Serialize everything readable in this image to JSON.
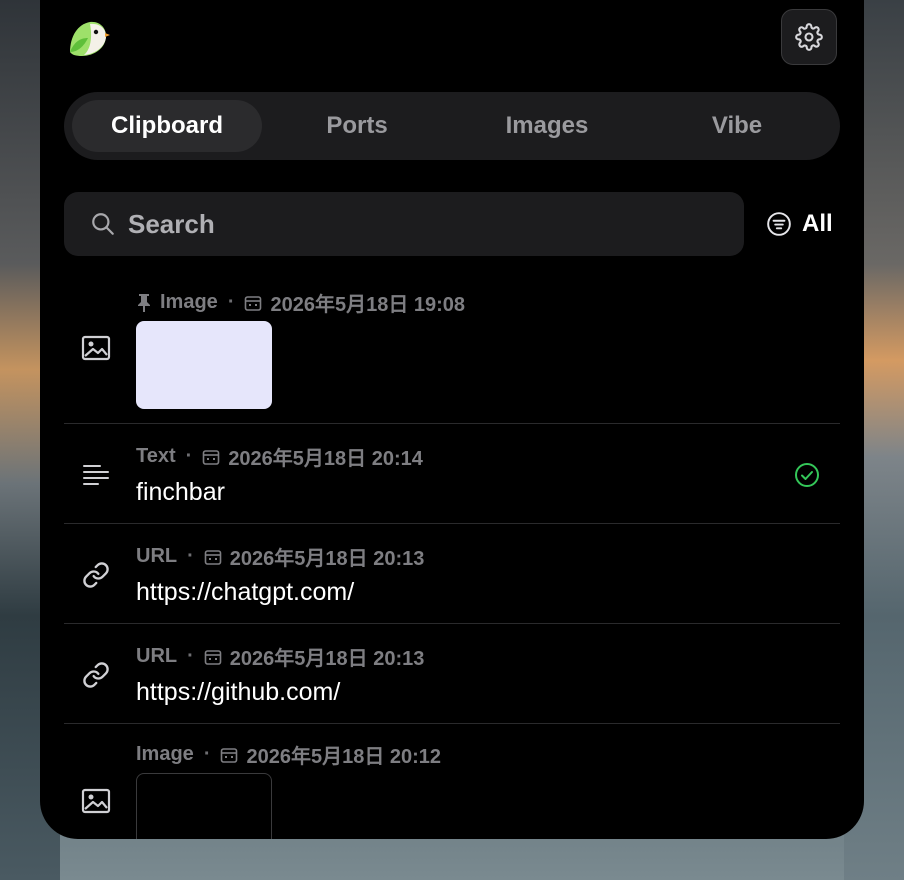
{
  "tabs": [
    {
      "label": "Clipboard",
      "active": true
    },
    {
      "label": "Ports",
      "active": false
    },
    {
      "label": "Images",
      "active": false
    },
    {
      "label": "Vibe",
      "active": false
    }
  ],
  "search": {
    "placeholder": "Search"
  },
  "filter": {
    "label": "All"
  },
  "items": [
    {
      "type": "Image",
      "pinned": true,
      "date": "2026年5月18日 19:08",
      "icon": "image-icon",
      "thumb_color": "#e6e6fb"
    },
    {
      "type": "Text",
      "date": "2026年5月18日 20:14",
      "content": "finchbar",
      "icon": "text-lines-icon",
      "selected": true
    },
    {
      "type": "URL",
      "date": "2026年5月18日 20:13",
      "content": "https://chatgpt.com/",
      "icon": "link-icon"
    },
    {
      "type": "URL",
      "date": "2026年5月18日 20:13",
      "content": "https://github.com/",
      "icon": "link-icon"
    },
    {
      "type": "Image",
      "date": "2026年5月18日 20:12",
      "icon": "image-icon",
      "thumb_color": "#000000"
    }
  ],
  "colors": {
    "accent_check": "#34c759",
    "panel_bg": "#000000",
    "surface": "#1c1c1e"
  },
  "separator": "·"
}
